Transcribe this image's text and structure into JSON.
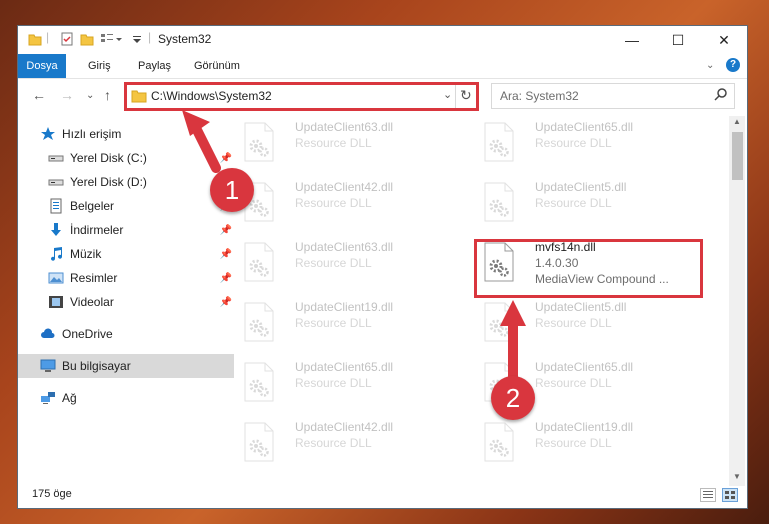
{
  "window": {
    "title": "System32"
  },
  "ribbon": {
    "tabs": [
      "Dosya",
      "Giriş",
      "Paylaş",
      "Görünüm"
    ]
  },
  "address": {
    "path": "C:\\Windows\\System32"
  },
  "search": {
    "placeholder": "Ara: System32"
  },
  "sidebar": {
    "items": [
      {
        "label": "Hızlı erişim",
        "icon": "star-icon"
      },
      {
        "label": "Yerel Disk (C:)",
        "icon": "drive-icon"
      },
      {
        "label": "Yerel Disk (D:)",
        "icon": "drive-icon"
      },
      {
        "label": "Belgeler",
        "icon": "document-icon"
      },
      {
        "label": "İndirmeler",
        "icon": "download-icon"
      },
      {
        "label": "Müzik",
        "icon": "music-icon"
      },
      {
        "label": "Resimler",
        "icon": "picture-icon"
      },
      {
        "label": "Videolar",
        "icon": "video-icon"
      },
      {
        "label": "OneDrive",
        "icon": "cloud-icon"
      },
      {
        "label": "Bu bilgisayar",
        "icon": "computer-icon"
      },
      {
        "label": "Ağ",
        "icon": "network-icon"
      }
    ]
  },
  "files": [
    {
      "name": "UpdateClient63.dll",
      "type": "Resource DLL"
    },
    {
      "name": "UpdateClient65.dll",
      "type": "Resource DLL"
    },
    {
      "name": "UpdateClient42.dll",
      "type": "Resource DLL"
    },
    {
      "name": "UpdateClient5.dll",
      "type": "Resource DLL"
    },
    {
      "name": "UpdateClient63.dll",
      "type": "Resource DLL"
    },
    {
      "name": "mvfs14n.dll",
      "version": "1.4.0.30",
      "description": "MediaView Compound ..."
    },
    {
      "name": "UpdateClient19.dll",
      "type": "Resource DLL"
    },
    {
      "name": "UpdateClient5.dll",
      "type": "Resource DLL"
    },
    {
      "name": "UpdateClient65.dll",
      "type": "Resource DLL"
    },
    {
      "name": "UpdateClient65.dll",
      "type": "Resource DLL"
    },
    {
      "name": "UpdateClient42.dll",
      "type": "Resource DLL"
    },
    {
      "name": "UpdateClient19.dll",
      "type": "Resource DLL"
    }
  ],
  "status": {
    "count": "175 öge"
  },
  "annotations": {
    "step1": "1",
    "step2": "2"
  },
  "colors": {
    "accent": "#1979ca",
    "highlight": "#d9363e"
  }
}
